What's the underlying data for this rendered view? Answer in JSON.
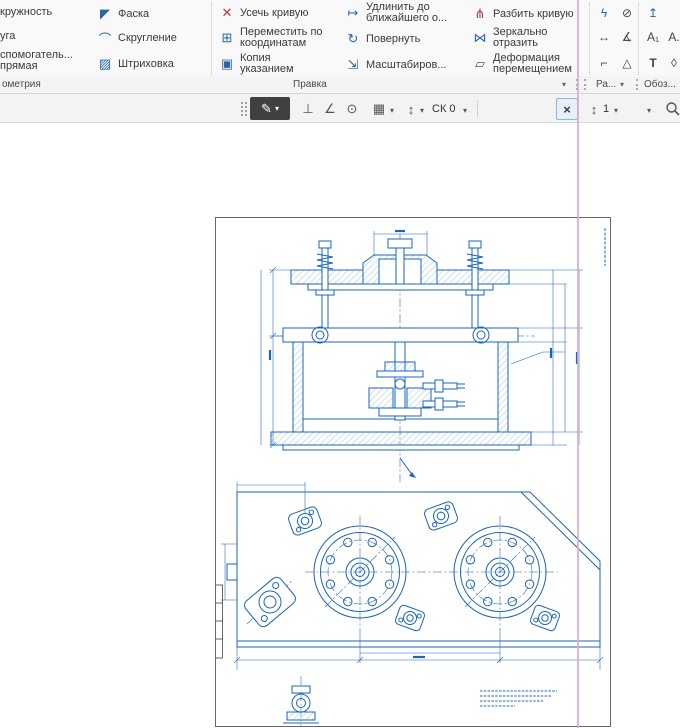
{
  "ribbon": {
    "buttons": {
      "circle": {
        "label": "кружность"
      },
      "arc": {
        "label": "уга"
      },
      "auxline": {
        "label": "спомогатель...",
        "label2": "прямая"
      },
      "chamfer": {
        "label": "Фаска"
      },
      "fillet": {
        "label": "Скругление"
      },
      "hatch": {
        "label": "Штриховка"
      },
      "trim": {
        "label": "Усечь кривую"
      },
      "move": {
        "label": "Переместить по",
        "label2": "координатам"
      },
      "copy": {
        "label": "Копия",
        "label2": "указанием"
      },
      "extend": {
        "label": "Удлинить до",
        "label2": "ближайшего о..."
      },
      "rotate": {
        "label": "Повернуть"
      },
      "scale": {
        "label": "Масштабиров..."
      },
      "split": {
        "label": "Разбить кривую"
      },
      "mirror": {
        "label": "Зеркально",
        "label2": "отразить"
      },
      "deform": {
        "label": "Деформация",
        "label2": "перемещением"
      }
    },
    "groups": {
      "geometry": "ометрия",
      "edit": "Правка",
      "dimensions": "Ра...",
      "designations": "Обоз..."
    }
  },
  "toolbar": {
    "coordinate_system": "СК 0",
    "layer": "1"
  },
  "icons": {
    "chamfer": "◤",
    "fillet": "⌒",
    "hatch": "▨",
    "trim": "✕",
    "move": "⊞",
    "copy": "▣",
    "extend": "↦",
    "rotate": "↻",
    "scale": "⇲",
    "split": "⋔",
    "mirror": "⋈",
    "deform": "▱",
    "dim_auto": "ϟ",
    "dim_diameter": "⊘",
    "dim_linear": "↔",
    "dim_angle": "∡",
    "dim_radial": "⌐",
    "dim_rough": "△",
    "note_up": "↥",
    "note_a1": "A₁",
    "note_a": "A.",
    "note_text": "T",
    "note_mark": "◊",
    "pen": "✎",
    "dropdown": "▾",
    "snap_perp": "⊥",
    "snap_angle": "∠",
    "snap_point": "⊙",
    "grid": "▦",
    "ruler": "↕",
    "cross_toggle": "×"
  },
  "colors": {
    "drawing_blue": "#1a64c2",
    "guide_pink": "#d9a9d5",
    "dark_button": "#404040",
    "toggle_selected_bg": "#e8f1fb"
  }
}
